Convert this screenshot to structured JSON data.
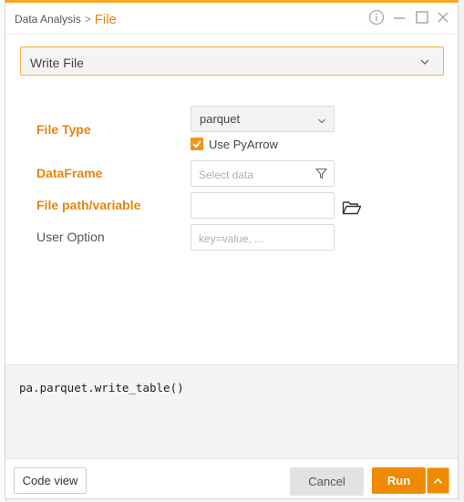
{
  "breadcrumb": {
    "parent": "Data Analysis",
    "separator": ">",
    "current": "File"
  },
  "function_select": {
    "value": "Write File"
  },
  "form": {
    "file_type": {
      "label": "File Type",
      "value": "parquet",
      "use_pyarrow_label": "Use PyArrow",
      "use_pyarrow_checked": true
    },
    "dataframe": {
      "label": "DataFrame",
      "placeholder": "Select data"
    },
    "file_path": {
      "label": "File path/variable",
      "value": ""
    },
    "user_option": {
      "label": "User Option",
      "placeholder": "key=value, ..."
    }
  },
  "code_preview": "pa.parquet.write_table()",
  "footer": {
    "code_view_label": "Code view",
    "cancel_label": "Cancel",
    "run_label": "Run"
  },
  "colors": {
    "accent": "#f08a00",
    "required_label": "#e8850c"
  },
  "icons": [
    "info-icon",
    "minimize-icon",
    "maximize-icon",
    "close-icon",
    "chevron-down-icon",
    "filter-icon",
    "folder-open-icon",
    "chevron-up-icon",
    "check-icon"
  ]
}
